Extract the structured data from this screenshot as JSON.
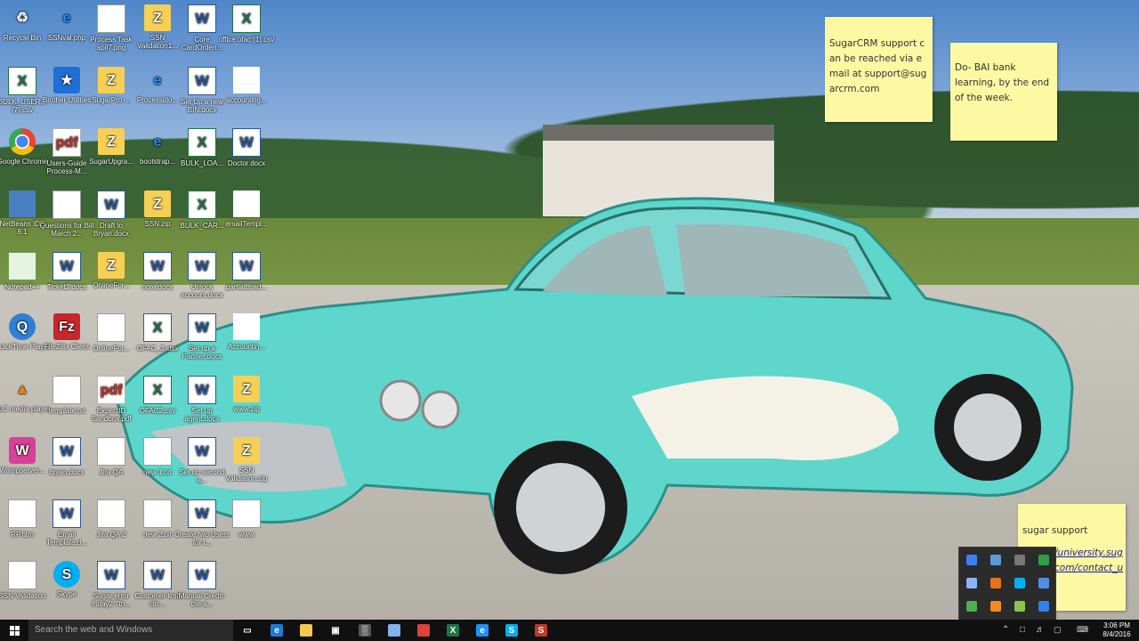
{
  "desktop": {
    "icons": [
      {
        "label": "Recycle Bin",
        "icon": "recycle-bin-icon",
        "glyph": "♻",
        "style": "g-bin"
      },
      {
        "label": "SSNval.php",
        "icon": "internet-explorer-icon",
        "glyph": "e",
        "style": "g-ie"
      },
      {
        "label": "Process Task apil7.png",
        "icon": "image-file-icon",
        "glyph": "",
        "style": "g-doc"
      },
      {
        "label": "SSN Validation1...",
        "icon": "folder-z-icon",
        "glyph": "Z",
        "style": "g-folder"
      },
      {
        "label": "Core CardOrderi...",
        "icon": "word-doc-icon",
        "glyph": "W",
        "style": "g-word"
      },
      {
        "label": "office ofac (1).csv",
        "icon": "excel-file-icon",
        "glyph": "X",
        "style": "g-excel"
      },
      {
        "label": "BULK_USER... (7).csv",
        "icon": "excel-file-icon",
        "glyph": "X",
        "style": "g-excel"
      },
      {
        "label": "Brother Utilities",
        "icon": "brother-utilities-icon",
        "glyph": "★",
        "style": "g-app"
      },
      {
        "label": "SugarPro-...",
        "icon": "folder-z-icon",
        "glyph": "Z",
        "style": "g-folder"
      },
      {
        "label": "Processido...",
        "icon": "internet-explorer-icon",
        "glyph": "e",
        "style": "g-ie"
      },
      {
        "label": "Set Up a new BIN.docx",
        "icon": "word-doc-icon",
        "glyph": "W",
        "style": "g-word"
      },
      {
        "label": "accounting...",
        "icon": "blank-file-icon",
        "glyph": "",
        "style": "g-wide"
      },
      {
        "label": "Google Chrome",
        "icon": "chrome-icon",
        "glyph": "",
        "style": "g-chrome"
      },
      {
        "label": "Users-Guide Process-M...",
        "icon": "pdf-file-icon",
        "glyph": "pdf",
        "style": "g-pdf"
      },
      {
        "label": "SugarUpgra...",
        "icon": "folder-z-icon",
        "glyph": "Z",
        "style": "g-folder"
      },
      {
        "label": "bootstrap...",
        "icon": "internet-explorer-icon",
        "glyph": "e",
        "style": "g-ie"
      },
      {
        "label": "BULK_LOA...",
        "icon": "excel-file-icon",
        "glyph": "X",
        "style": "g-excel"
      },
      {
        "label": "Doctor.docx",
        "icon": "word-doc-icon",
        "glyph": "W",
        "style": "g-word"
      },
      {
        "label": "NetBeans IDE 8.1",
        "icon": "netbeans-icon",
        "glyph": "",
        "style": "g-cube"
      },
      {
        "label": "Questions for Bill March 2...",
        "icon": "text-file-icon",
        "glyph": "",
        "style": "g-doc"
      },
      {
        "label": "Draft to Bryan.docx",
        "icon": "word-doc-icon",
        "glyph": "W",
        "style": "g-word"
      },
      {
        "label": "SSN.zip",
        "icon": "folder-z-icon",
        "glyph": "Z",
        "style": "g-folder"
      },
      {
        "label": "BULK_CAR...",
        "icon": "excel-file-icon",
        "glyph": "X",
        "style": "g-excel"
      },
      {
        "label": "emailTempl...",
        "icon": "blank-file-icon",
        "glyph": "",
        "style": "g-wide"
      },
      {
        "label": "Notepad++",
        "icon": "notepad-plus-icon",
        "glyph": "",
        "style": "g-note"
      },
      {
        "label": "Ticket2.docx",
        "icon": "word-doc-icon",
        "glyph": "W",
        "style": "g-word"
      },
      {
        "label": "OnlineFor...",
        "icon": "folder-z-icon",
        "glyph": "Z",
        "style": "g-folder"
      },
      {
        "label": "note.docx",
        "icon": "word-doc-icon",
        "glyph": "W",
        "style": "g-word"
      },
      {
        "label": "Unlock account.docx",
        "icon": "word-doc-icon",
        "glyph": "W",
        "style": "g-word"
      },
      {
        "label": "partialLoad...",
        "icon": "word-doc-icon",
        "glyph": "W",
        "style": "g-word"
      },
      {
        "label": "QuickTime Player",
        "icon": "quicktime-icon",
        "glyph": "Q",
        "style": "g-qt"
      },
      {
        "label": "FileZilla Client",
        "icon": "filezilla-icon",
        "glyph": "Fz",
        "style": "g-red"
      },
      {
        "label": "OnlineFor...",
        "icon": "image-file-icon",
        "glyph": "",
        "style": "g-doc"
      },
      {
        "label": "OFAC_3.xlsx",
        "icon": "excel-file-icon",
        "glyph": "X",
        "style": "g-excel"
      },
      {
        "label": "Set up a Partner.docx",
        "icon": "word-doc-icon",
        "glyph": "W",
        "style": "g-word"
      },
      {
        "label": "Accountin...",
        "icon": "blank-file-icon",
        "glyph": "",
        "style": "g-wide"
      },
      {
        "label": "VLC media player",
        "icon": "vlc-icon",
        "glyph": "▲",
        "style": "g-orange"
      },
      {
        "label": "template.txt",
        "icon": "text-file-icon",
        "glyph": "",
        "style": "g-doc"
      },
      {
        "label": "ExpectID Sandbox.pdf",
        "icon": "pdf-file-icon",
        "glyph": "pdf",
        "style": "g-pdf"
      },
      {
        "label": "OFAC2.csv",
        "icon": "excel-file-icon",
        "glyph": "X",
        "style": "g-excel"
      },
      {
        "label": "Set up agent.docx",
        "icon": "word-doc-icon",
        "glyph": "W",
        "style": "g-word"
      },
      {
        "label": "www.zip",
        "icon": "folder-z-icon",
        "glyph": "Z",
        "style": "g-folder"
      },
      {
        "label": "Wampserver...",
        "icon": "wampserver-icon",
        "glyph": "W",
        "style": "g-pink"
      },
      {
        "label": "bryan.docx",
        "icon": "word-doc-icon",
        "glyph": "W",
        "style": "g-word"
      },
      {
        "label": "Jira QA",
        "icon": "image-file-icon",
        "glyph": "",
        "style": "g-doc"
      },
      {
        "label": "new 1.txt",
        "icon": "text-file-icon",
        "glyph": "",
        "style": "g-doc"
      },
      {
        "label": "Set up second a...",
        "icon": "word-doc-icon",
        "glyph": "W",
        "style": "g-word"
      },
      {
        "label": "SSN Validation.zip",
        "icon": "folder-z-icon",
        "glyph": "Z",
        "style": "g-folder"
      },
      {
        "label": "RP.htm",
        "icon": "html-file-icon",
        "glyph": "",
        "style": "g-doc"
      },
      {
        "label": "Email Template.d...",
        "icon": "word-doc-icon",
        "glyph": "W",
        "style": "g-word"
      },
      {
        "label": "Jira QA 2",
        "icon": "image-file-icon",
        "glyph": "",
        "style": "g-doc"
      },
      {
        "label": "new 2.txt",
        "icon": "text-file-icon",
        "glyph": "",
        "style": "g-doc"
      },
      {
        "label": "Create two Users for t...",
        "icon": "word-doc-icon",
        "glyph": "W",
        "style": "g-word"
      },
      {
        "label": "www",
        "icon": "image-file-icon",
        "glyph": "",
        "style": "g-doc"
      },
      {
        "label": "SSN Validation",
        "icon": "html-file-icon",
        "glyph": "",
        "style": "g-doc"
      },
      {
        "label": "Skype",
        "icon": "skype-icon",
        "glyph": "S",
        "style": "g-skype"
      },
      {
        "label": "Sugar error friday2 7th...",
        "icon": "word-doc-icon",
        "glyph": "W",
        "style": "g-word"
      },
      {
        "label": "Customer limit clic...",
        "icon": "word-doc-icon",
        "glyph": "W",
        "style": "g-word"
      },
      {
        "label": "Manual Credit- the a...",
        "icon": "word-doc-icon",
        "glyph": "W",
        "style": "g-word"
      }
    ]
  },
  "sticky_notes": {
    "note1": {
      "text": "SugarCRM support can be reached via email at support@sugarcrm.com"
    },
    "note2": {
      "text": "Do- BAI bank learning, by the end of the week."
    },
    "note3": {
      "title": "sugar support",
      "link_line1": "/university.sug",
      "link_line2": "com/contact_u"
    }
  },
  "taskbar": {
    "search_placeholder": "Search the web and Windows",
    "apps": [
      {
        "name": "task-view-icon",
        "glyph": "▭",
        "color": "#101010"
      },
      {
        "name": "edge-icon",
        "glyph": "e",
        "color": "#1f7bd6"
      },
      {
        "name": "file-explorer-icon",
        "glyph": "",
        "color": "#f2c94c"
      },
      {
        "name": "store-icon",
        "glyph": "▣",
        "color": "#101010"
      },
      {
        "name": "calculator-icon",
        "glyph": "▒",
        "color": "#555555"
      },
      {
        "name": "photos-icon",
        "glyph": "",
        "color": "#7fb4e8"
      },
      {
        "name": "chrome-taskbar-icon",
        "glyph": "",
        "color": "#db4437"
      },
      {
        "name": "excel-taskbar-icon",
        "glyph": "X",
        "color": "#217346"
      },
      {
        "name": "ie-taskbar-icon",
        "glyph": "e",
        "color": "#1e90ff"
      },
      {
        "name": "skype-taskbar-icon",
        "glyph": "S",
        "color": "#00aff0"
      },
      {
        "name": "sugar-taskbar-icon",
        "glyph": "S",
        "color": "#c0392b"
      }
    ],
    "clock_time": "3:06 PM",
    "clock_date": "8/4/2016"
  },
  "tray_popup": {
    "icons": [
      {
        "name": "tray-app-blue-icon",
        "color": "#3b82f6"
      },
      {
        "name": "tray-sync-icon",
        "color": "#5b9bd5"
      },
      {
        "name": "tray-cloud-icon",
        "color": "#777777"
      },
      {
        "name": "tray-green-icon",
        "color": "#2ea043"
      },
      {
        "name": "tray-window-icon",
        "color": "#8ab4f8"
      },
      {
        "name": "tray-orange-icon",
        "color": "#e8711c"
      },
      {
        "name": "tray-skype-icon",
        "color": "#00aff0"
      },
      {
        "name": "tray-blue2-icon",
        "color": "#4f8fe6"
      },
      {
        "name": "tray-gear-icon",
        "color": "#4caf50"
      },
      {
        "name": "tray-orange2-icon",
        "color": "#f28b1c"
      },
      {
        "name": "tray-lime-icon",
        "color": "#8bc34a"
      },
      {
        "name": "tray-arrow-icon",
        "color": "#2f80ed"
      }
    ]
  }
}
